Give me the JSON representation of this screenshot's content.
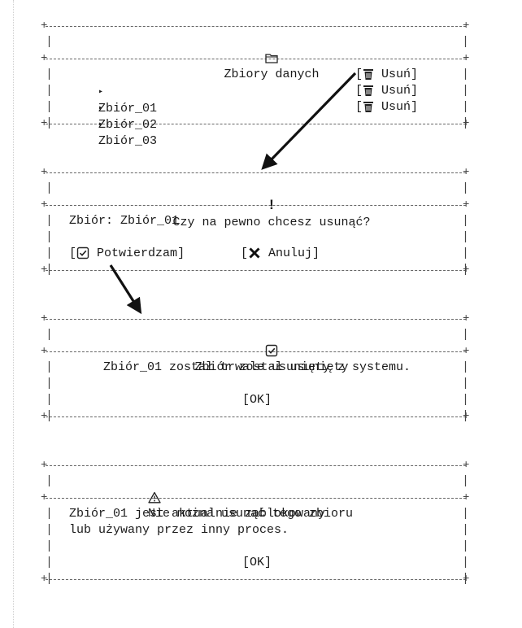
{
  "datasets": {
    "title": "Zbiory danych",
    "items": [
      {
        "bullet": "▸",
        "name": "Zbiór_01",
        "delete": "Usuń"
      },
      {
        "bullet": "▸",
        "name": "Zbiór_02",
        "delete": "Usuń"
      },
      {
        "bullet": "▸",
        "name": "Zbiór_03",
        "delete": "Usuń"
      }
    ]
  },
  "confirm": {
    "title": "Czy na pewno chcesz usunąć?",
    "line": "Zbiór: Zbiór_01",
    "confirm_label": "Potwierdzam",
    "cancel_label": "Anuluj"
  },
  "success": {
    "title": "Zbiór został usunięty",
    "message": "Zbiór_01 został trwale usunięty z systemu.",
    "ok": "[OK]"
  },
  "error": {
    "title": "Nie można usunąć tego zbioru",
    "line1": "Zbiór_01 jest aktualnie zablokowany",
    "line2": "lub używany przez inny proces.",
    "ok": "[OK]"
  }
}
